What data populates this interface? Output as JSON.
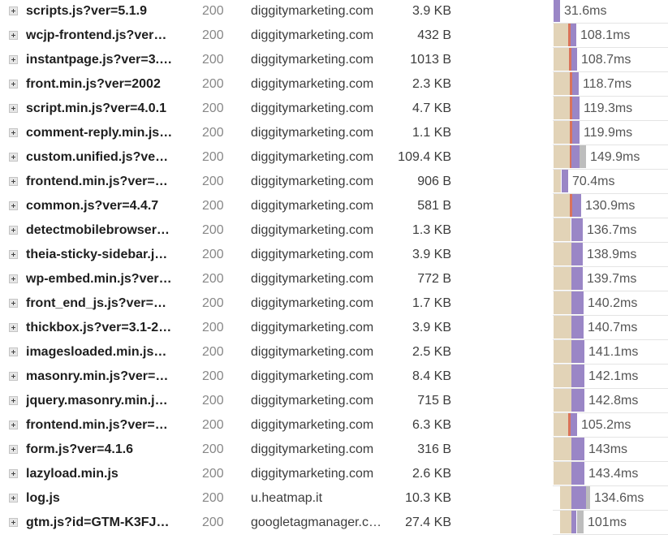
{
  "colors": {
    "blocked": "#e2d3b7",
    "connect": "#d9735a",
    "wait": "#9a86c6",
    "receive": "#bdbdbd"
  },
  "icons": {
    "expand": "plus-box-icon"
  },
  "requests": [
    {
      "name": "scripts.js?ver=5.1.9",
      "status": "200",
      "domain": "diggitymarketing.com",
      "size": "3.9 KB",
      "time": "31.6ms"
    },
    {
      "name": "wcjp-frontend.js?ver…",
      "status": "200",
      "domain": "diggitymarketing.com",
      "size": "432 B",
      "time": "108.1ms"
    },
    {
      "name": "instantpage.js?ver=3.…",
      "status": "200",
      "domain": "diggitymarketing.com",
      "size": "1013 B",
      "time": "108.7ms"
    },
    {
      "name": "front.min.js?ver=2002",
      "status": "200",
      "domain": "diggitymarketing.com",
      "size": "2.3 KB",
      "time": "118.7ms"
    },
    {
      "name": "script.min.js?ver=4.0.1",
      "status": "200",
      "domain": "diggitymarketing.com",
      "size": "4.7 KB",
      "time": "119.3ms"
    },
    {
      "name": "comment-reply.min.js…",
      "status": "200",
      "domain": "diggitymarketing.com",
      "size": "1.1 KB",
      "time": "119.9ms"
    },
    {
      "name": "custom.unified.js?ve…",
      "status": "200",
      "domain": "diggitymarketing.com",
      "size": "109.4 KB",
      "time": "149.9ms"
    },
    {
      "name": "frontend.min.js?ver=…",
      "status": "200",
      "domain": "diggitymarketing.com",
      "size": "906 B",
      "time": "70.4ms"
    },
    {
      "name": "common.js?ver=4.4.7",
      "status": "200",
      "domain": "diggitymarketing.com",
      "size": "581 B",
      "time": "130.9ms"
    },
    {
      "name": "detectmobilebrowser…",
      "status": "200",
      "domain": "diggitymarketing.com",
      "size": "1.3 KB",
      "time": "136.7ms"
    },
    {
      "name": "theia-sticky-sidebar.j…",
      "status": "200",
      "domain": "diggitymarketing.com",
      "size": "3.9 KB",
      "time": "138.9ms"
    },
    {
      "name": "wp-embed.min.js?ver…",
      "status": "200",
      "domain": "diggitymarketing.com",
      "size": "772 B",
      "time": "139.7ms"
    },
    {
      "name": "front_end_js.js?ver=…",
      "status": "200",
      "domain": "diggitymarketing.com",
      "size": "1.7 KB",
      "time": "140.2ms"
    },
    {
      "name": "thickbox.js?ver=3.1-2…",
      "status": "200",
      "domain": "diggitymarketing.com",
      "size": "3.9 KB",
      "time": "140.7ms"
    },
    {
      "name": "imagesloaded.min.js…",
      "status": "200",
      "domain": "diggitymarketing.com",
      "size": "2.5 KB",
      "time": "141.1ms"
    },
    {
      "name": "masonry.min.js?ver=…",
      "status": "200",
      "domain": "diggitymarketing.com",
      "size": "8.4 KB",
      "time": "142.1ms"
    },
    {
      "name": "jquery.masonry.min.j…",
      "status": "200",
      "domain": "diggitymarketing.com",
      "size": "715 B",
      "time": "142.8ms"
    },
    {
      "name": "frontend.min.js?ver=…",
      "status": "200",
      "domain": "diggitymarketing.com",
      "size": "6.3 KB",
      "time": "105.2ms"
    },
    {
      "name": "form.js?ver=4.1.6",
      "status": "200",
      "domain": "diggitymarketing.com",
      "size": "316 B",
      "time": "143ms"
    },
    {
      "name": "lazyload.min.js",
      "status": "200",
      "domain": "diggitymarketing.com",
      "size": "2.6 KB",
      "time": "143.4ms"
    },
    {
      "name": "log.js",
      "status": "200",
      "domain": "u.heatmap.it",
      "size": "10.3 KB",
      "time": "134.6ms"
    },
    {
      "name": "gtm.js?id=GTM-K3FJ…",
      "status": "200",
      "domain": "googletagmanager.c…",
      "size": "27.4 KB",
      "time": "101ms"
    }
  ]
}
